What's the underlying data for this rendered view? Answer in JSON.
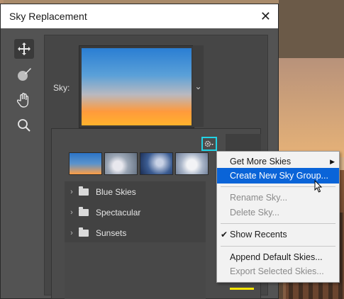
{
  "dialog": {
    "title": "Sky Replacement"
  },
  "tools": [
    "move-tool",
    "brush-tool",
    "hand-tool",
    "zoom-tool"
  ],
  "sky": {
    "label": "Sky:"
  },
  "folders": [
    {
      "label": "Blue Skies"
    },
    {
      "label": "Spectacular"
    },
    {
      "label": "Sunsets"
    }
  ],
  "menu": {
    "items": [
      {
        "label": "Get More Skies"
      },
      {
        "label": "Create New Sky Group..."
      },
      {
        "label": "Rename Sky..."
      },
      {
        "label": "Delete Sky..."
      },
      {
        "label": "Show Recents"
      },
      {
        "label": "Append Default Skies..."
      },
      {
        "label": "Export Selected Skies..."
      }
    ]
  },
  "colors": {
    "highlight": "#0a64d8",
    "focus_ring": "#22d3e6",
    "dialog_bg": "#535353"
  }
}
